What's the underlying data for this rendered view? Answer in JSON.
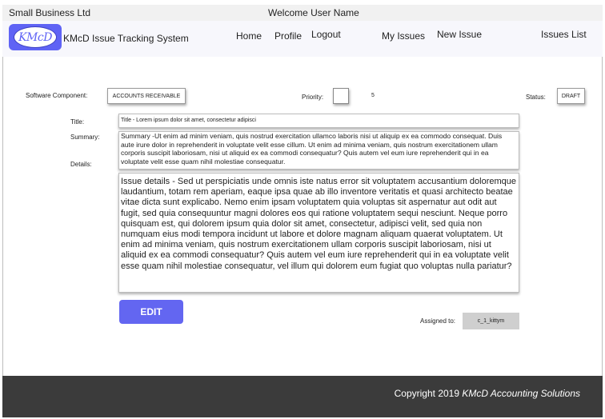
{
  "header": {
    "company": "Small Business Ltd",
    "welcome": "Welcome User Name"
  },
  "nav": {
    "logo_text": "KMcD",
    "app_title": "KMcD Issue Tracking System",
    "links": {
      "home": "Home",
      "profile": "Profile",
      "logout": "Logout",
      "my_issues": "My Issues",
      "new_issue": "New Issue",
      "issues_list": "Issues List"
    }
  },
  "issue": {
    "software_component_label": "Software Component:",
    "software_component_value": "ACCOUNTS RECEIVABLE",
    "priority_label": "Priority:",
    "priority_value": "5",
    "status_label": "Status:",
    "status_value": "DRAFT",
    "title_label": "Title:",
    "title_value": "Title - Lorem ipsum dolor sit amet, consectetur adipisci",
    "summary_label": "Summary:",
    "summary_value": "Summary -Ut enim ad minim veniam, quis nostrud exercitation ullamco laboris nisi ut aliquip ex ea commodo consequat. Duis aute irure dolor in reprehenderit in voluptate velit esse cillum. Ut enim ad minima veniam, quis nostrum exercitationem ullam corporis suscipit laboriosam, nisi ut aliquid ex ea commodi consequatur? Quis autem vel eum iure reprehenderit qui in ea voluptate velit esse quam nihil molestiae consequatur.",
    "details_label": "Details:",
    "details_value": "Issue details - Sed ut perspiciatis unde omnis iste natus error sit voluptatem accusantium doloremque laudantium, totam rem aperiam, eaque ipsa quae ab illo inventore veritatis et quasi architecto beatae vitae dicta sunt explicabo. Nemo enim ipsam voluptatem quia voluptas sit aspernatur aut odit aut fugit, sed quia consequuntur magni dolores eos qui ratione voluptatem sequi nesciunt. Neque porro quisquam est, qui dolorem ipsum quia dolor sit amet, consectetur, adipisci velit, sed quia non numquam eius modi tempora incidunt ut labore et dolore magnam aliquam quaerat voluptatem.  Ut enim ad minima veniam, quis nostrum exercitationem ullam corporis suscipit laboriosam, nisi ut aliquid ex ea commodi consequatur? Quis autem vel eum iure reprehenderit qui in ea voluptate velit esse quam nihil molestiae consequatur, vel illum qui dolorem eum fugiat quo voluptas nulla pariatur?",
    "edit_label": "EDIT",
    "assigned_label": "Assigned to:",
    "assigned_value": "c_1_kittym"
  },
  "footer": {
    "copyright_prefix": "Copyright 2019",
    "copyright_org": "KMcD Accounting Solutions"
  },
  "colors": {
    "accent": "#6366f1",
    "footer_bg": "#3b3b3b",
    "topbar_bg": "#f1f1f1",
    "assigned_bg": "#cfcfcf"
  },
  "icons": {
    "logo": "kmcd-logo-icon"
  }
}
